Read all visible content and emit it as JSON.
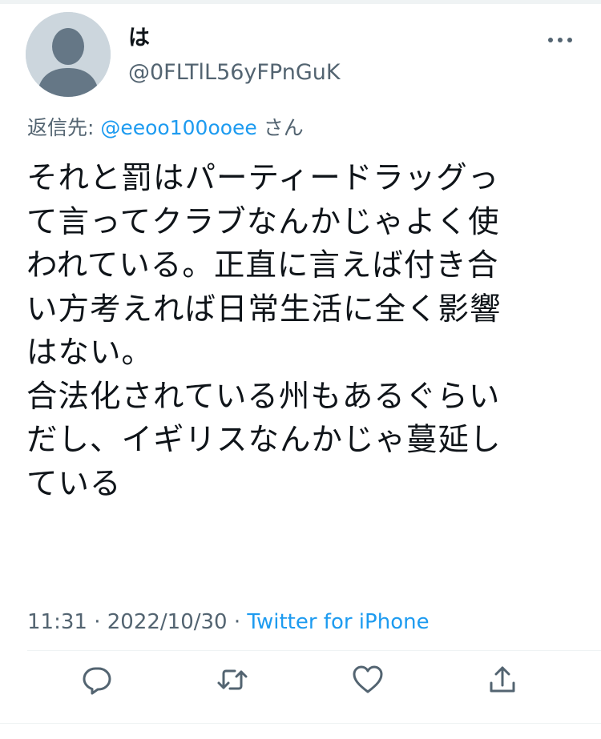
{
  "author": {
    "display_name": "は",
    "handle": "@0FLTlL56yFPnGuK",
    "avatar_icon": "default-profile-icon"
  },
  "reply_to": {
    "prefix": "返信先: ",
    "mention": "@eeoo100ooee",
    "suffix": " さん"
  },
  "tweet": {
    "text": "それと罰はパーティードラッグっ\nて言ってクラブなんかじゃよく使\nわれている。正直に言えば付き合\nい方考えれば日常生活に全く影響\nはない。\n合法化されている州もあるぐらい\nだし、イギリスなんかじゃ蔓延し\nている"
  },
  "meta": {
    "time": "11:31",
    "separator_1": " · ",
    "date": "2022/10/30",
    "separator_2": " · ",
    "source": "Twitter for iPhone"
  },
  "actions": [
    {
      "name": "reply",
      "icon": "reply-icon"
    },
    {
      "name": "retweet",
      "icon": "retweet-icon"
    },
    {
      "name": "like",
      "icon": "heart-icon"
    },
    {
      "name": "share",
      "icon": "share-icon"
    }
  ],
  "colors": {
    "text": "#0f1419",
    "secondary": "#536471",
    "accent": "#1d9bf0",
    "avatar_bg": "#ccd6dd",
    "avatar_fg": "#657786"
  }
}
